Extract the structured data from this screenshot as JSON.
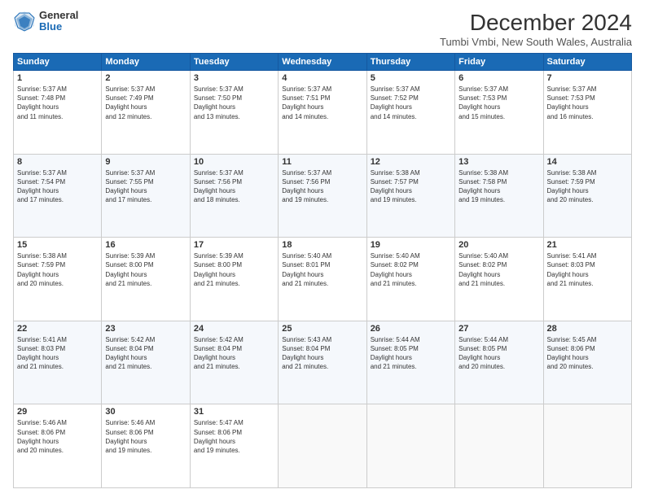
{
  "logo": {
    "general": "General",
    "blue": "Blue"
  },
  "title": "December 2024",
  "location": "Tumbi Vmbi, New South Wales, Australia",
  "days_header": [
    "Sunday",
    "Monday",
    "Tuesday",
    "Wednesday",
    "Thursday",
    "Friday",
    "Saturday"
  ],
  "weeks": [
    [
      {
        "day": "1",
        "sunrise": "5:37 AM",
        "sunset": "7:48 PM",
        "daylight": "14 hours and 11 minutes."
      },
      {
        "day": "2",
        "sunrise": "5:37 AM",
        "sunset": "7:49 PM",
        "daylight": "14 hours and 12 minutes."
      },
      {
        "day": "3",
        "sunrise": "5:37 AM",
        "sunset": "7:50 PM",
        "daylight": "14 hours and 13 minutes."
      },
      {
        "day": "4",
        "sunrise": "5:37 AM",
        "sunset": "7:51 PM",
        "daylight": "14 hours and 14 minutes."
      },
      {
        "day": "5",
        "sunrise": "5:37 AM",
        "sunset": "7:52 PM",
        "daylight": "14 hours and 14 minutes."
      },
      {
        "day": "6",
        "sunrise": "5:37 AM",
        "sunset": "7:53 PM",
        "daylight": "14 hours and 15 minutes."
      },
      {
        "day": "7",
        "sunrise": "5:37 AM",
        "sunset": "7:53 PM",
        "daylight": "14 hours and 16 minutes."
      }
    ],
    [
      {
        "day": "8",
        "sunrise": "5:37 AM",
        "sunset": "7:54 PM",
        "daylight": "14 hours and 17 minutes."
      },
      {
        "day": "9",
        "sunrise": "5:37 AM",
        "sunset": "7:55 PM",
        "daylight": "14 hours and 17 minutes."
      },
      {
        "day": "10",
        "sunrise": "5:37 AM",
        "sunset": "7:56 PM",
        "daylight": "14 hours and 18 minutes."
      },
      {
        "day": "11",
        "sunrise": "5:37 AM",
        "sunset": "7:56 PM",
        "daylight": "14 hours and 19 minutes."
      },
      {
        "day": "12",
        "sunrise": "5:38 AM",
        "sunset": "7:57 PM",
        "daylight": "14 hours and 19 minutes."
      },
      {
        "day": "13",
        "sunrise": "5:38 AM",
        "sunset": "7:58 PM",
        "daylight": "14 hours and 19 minutes."
      },
      {
        "day": "14",
        "sunrise": "5:38 AM",
        "sunset": "7:59 PM",
        "daylight": "14 hours and 20 minutes."
      }
    ],
    [
      {
        "day": "15",
        "sunrise": "5:38 AM",
        "sunset": "7:59 PM",
        "daylight": "14 hours and 20 minutes."
      },
      {
        "day": "16",
        "sunrise": "5:39 AM",
        "sunset": "8:00 PM",
        "daylight": "14 hours and 21 minutes."
      },
      {
        "day": "17",
        "sunrise": "5:39 AM",
        "sunset": "8:00 PM",
        "daylight": "14 hours and 21 minutes."
      },
      {
        "day": "18",
        "sunrise": "5:40 AM",
        "sunset": "8:01 PM",
        "daylight": "14 hours and 21 minutes."
      },
      {
        "day": "19",
        "sunrise": "5:40 AM",
        "sunset": "8:02 PM",
        "daylight": "14 hours and 21 minutes."
      },
      {
        "day": "20",
        "sunrise": "5:40 AM",
        "sunset": "8:02 PM",
        "daylight": "14 hours and 21 minutes."
      },
      {
        "day": "21",
        "sunrise": "5:41 AM",
        "sunset": "8:03 PM",
        "daylight": "14 hours and 21 minutes."
      }
    ],
    [
      {
        "day": "22",
        "sunrise": "5:41 AM",
        "sunset": "8:03 PM",
        "daylight": "14 hours and 21 minutes."
      },
      {
        "day": "23",
        "sunrise": "5:42 AM",
        "sunset": "8:04 PM",
        "daylight": "14 hours and 21 minutes."
      },
      {
        "day": "24",
        "sunrise": "5:42 AM",
        "sunset": "8:04 PM",
        "daylight": "14 hours and 21 minutes."
      },
      {
        "day": "25",
        "sunrise": "5:43 AM",
        "sunset": "8:04 PM",
        "daylight": "14 hours and 21 minutes."
      },
      {
        "day": "26",
        "sunrise": "5:44 AM",
        "sunset": "8:05 PM",
        "daylight": "14 hours and 21 minutes."
      },
      {
        "day": "27",
        "sunrise": "5:44 AM",
        "sunset": "8:05 PM",
        "daylight": "14 hours and 20 minutes."
      },
      {
        "day": "28",
        "sunrise": "5:45 AM",
        "sunset": "8:06 PM",
        "daylight": "14 hours and 20 minutes."
      }
    ],
    [
      {
        "day": "29",
        "sunrise": "5:46 AM",
        "sunset": "8:06 PM",
        "daylight": "14 hours and 20 minutes."
      },
      {
        "day": "30",
        "sunrise": "5:46 AM",
        "sunset": "8:06 PM",
        "daylight": "14 hours and 19 minutes."
      },
      {
        "day": "31",
        "sunrise": "5:47 AM",
        "sunset": "8:06 PM",
        "daylight": "14 hours and 19 minutes."
      },
      null,
      null,
      null,
      null
    ]
  ]
}
